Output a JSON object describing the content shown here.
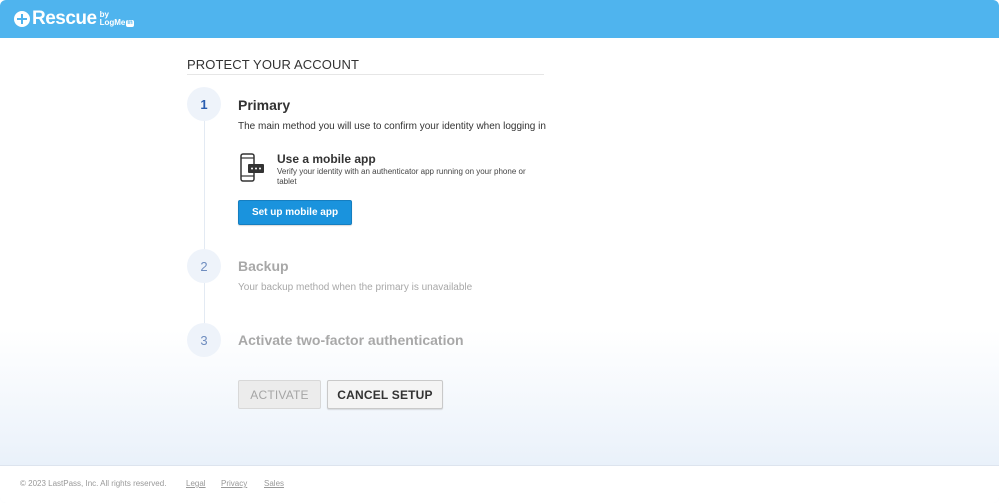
{
  "header": {
    "brand": "Rescue",
    "brand_by": "by",
    "brand_sub": "LogMe",
    "brand_sub_in": "In",
    "background_color": "#4fb4ee"
  },
  "page": {
    "title": "PROTECT YOUR ACCOUNT"
  },
  "steps": [
    {
      "number": "1",
      "title": "Primary",
      "description": "The main method you will use to confirm your identity when logging in",
      "state": "active"
    },
    {
      "number": "2",
      "title": "Backup",
      "description": "Your backup method when the primary is unavailable",
      "state": "disabled"
    },
    {
      "number": "3",
      "title": "Activate two-factor authentication",
      "state": "disabled"
    }
  ],
  "method": {
    "icon": "mobile-phone-icon",
    "title": "Use a mobile app",
    "description": "Verify your identity with an authenticator app running on your phone or tablet",
    "button_label": "Set up mobile app",
    "button_color": "#1a93dd"
  },
  "actions": {
    "activate_label": "ACTIVATE",
    "activate_enabled": false,
    "cancel_label": "CANCEL SETUP"
  },
  "footer": {
    "copyright": "© 2023 LastPass, Inc. All rights reserved.",
    "links": [
      "Legal",
      "Privacy",
      "Sales"
    ]
  }
}
